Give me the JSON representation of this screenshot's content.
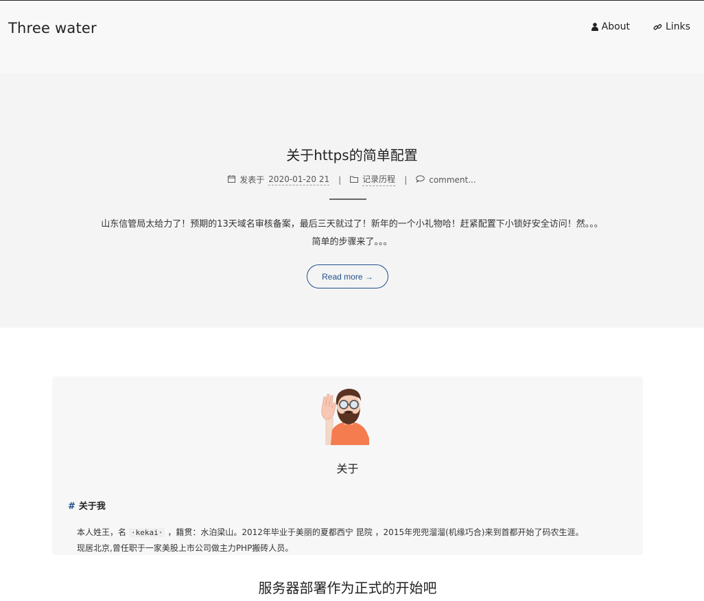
{
  "site": {
    "title": "Three water"
  },
  "nav": {
    "about": {
      "label": "About",
      "icon": "user-icon"
    },
    "links": {
      "label": "Links",
      "icon": "link-icon"
    }
  },
  "post": {
    "title": "关于https的简单配置",
    "meta": {
      "published_prefix": "发表于",
      "date": "2020-01-20 21",
      "category": "记录历程",
      "comments": "comment..."
    },
    "excerpt_line1": "山东信管局太给力了！预期的13天域名审核备案，最后三天就过了！新年的一个小礼物哈！赶紧配置下小锁好安全访问！然。。。",
    "excerpt_line2": "简单的步骤来了。。。",
    "read_more": "Read more →"
  },
  "about_card": {
    "title": "关于",
    "section_heading_hash": "#",
    "section_heading": "关于我",
    "bio_part1": "本人姓王，名",
    "bio_code": "·kekai·",
    "bio_part2": "，籍贯：水泊梁山。2012年毕业于美丽的夏都西宁  昆院  ，2015年兜兜溜溜(机缘巧合)来到首都开始了码农生涯。",
    "bio_line2": "现居北京,曾任职于一家美股上市公司做主力PHP搬砖人员。"
  },
  "next_post": {
    "title": "服务器部署作为正式的开始吧"
  },
  "colors": {
    "accent": "#1e4e8c",
    "header_bg": "#f8f8f8",
    "post_bg": "#f4f4f4"
  }
}
